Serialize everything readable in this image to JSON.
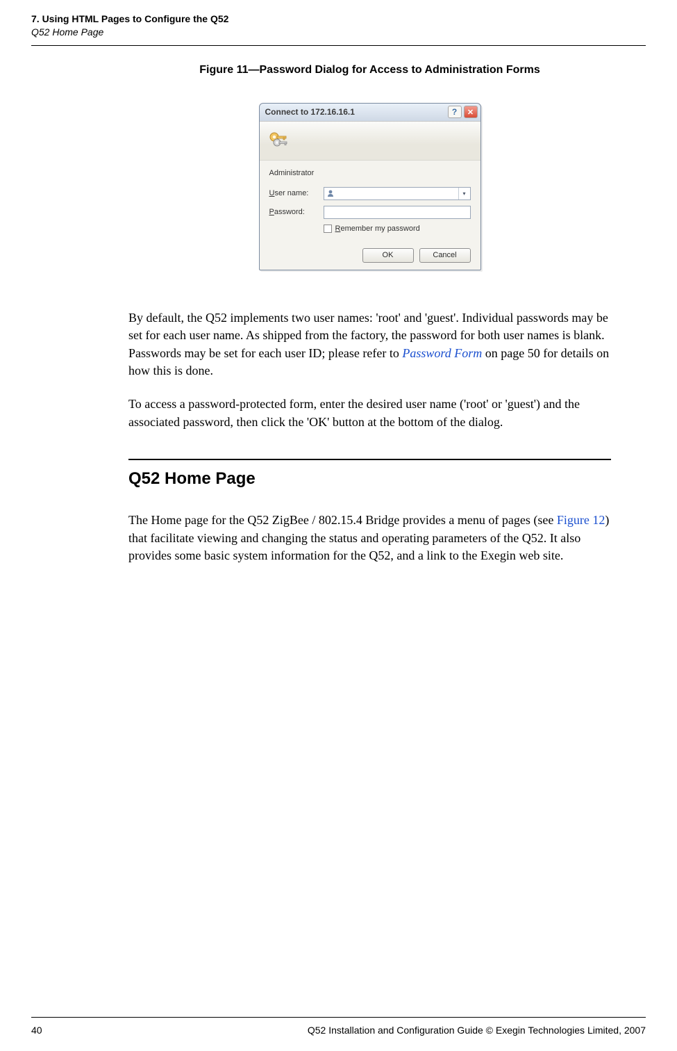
{
  "header": {
    "chapter": "7. Using HTML Pages to Configure the Q52",
    "section": "Q52 Home Page"
  },
  "figure": {
    "caption": "Figure 11—Password Dialog for Access to Administration Forms"
  },
  "dialog": {
    "title": "Connect to 172.16.16.1",
    "realm": "Administrator",
    "username_label_pre": "U",
    "username_label_rest": "ser name:",
    "password_label_pre": "P",
    "password_label_rest": "assword:",
    "remember_pre": "R",
    "remember_rest": "emember my password",
    "ok": "OK",
    "cancel": "Cancel"
  },
  "paragraphs": {
    "p1_a": "By default, the Q52 implements two user names: 'root' and 'guest'. Individual passwords may be set for each user name. As shipped from the factory, the password for both user names is blank. Passwords may be set for each user ID; please refer to ",
    "p1_link": "Password Form",
    "p1_b": " on page 50 for details on how this is done.",
    "p2": "To access a password-protected form, enter the desired user name ('root' or 'guest') and the associated password, then click the 'OK' button at the bottom of the dialog."
  },
  "section": {
    "heading": "Q52 Home Page",
    "body_a": "The Home page for the Q52 ZigBee / 802.15.4 Bridge provides a menu of pages (see ",
    "body_link": "Figure 12",
    "body_b": ") that facilitate viewing and changing the status and operating parameters of the Q52. It also provides some basic system information for the Q52, and a link to the Exegin web site."
  },
  "footer": {
    "page": "40",
    "text": "Q52 Installation and Configuration Guide  © Exegin Technologies Limited, 2007"
  }
}
